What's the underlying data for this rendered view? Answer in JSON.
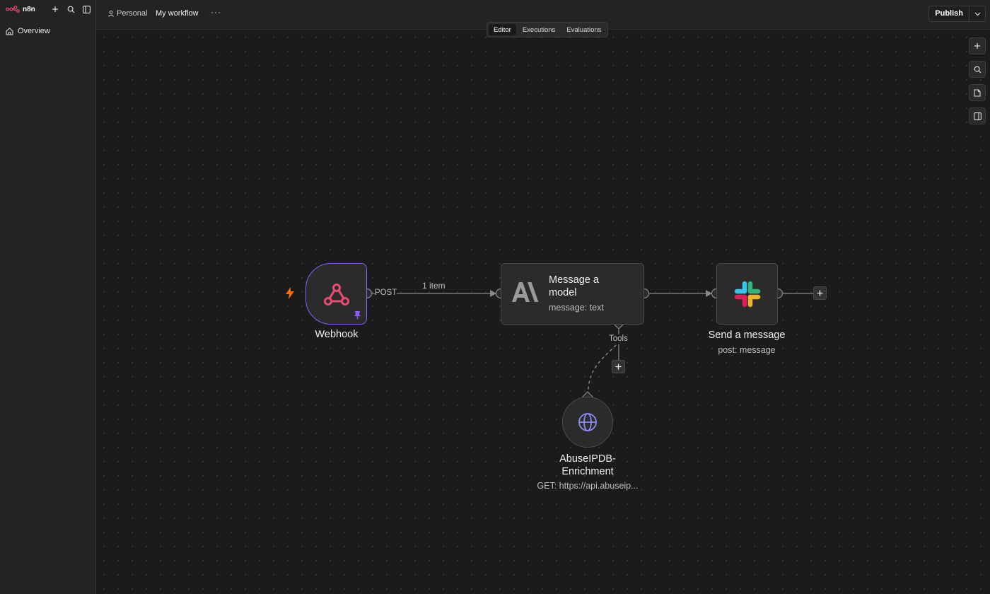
{
  "sidebar": {
    "brand": "n8n",
    "nav": [
      {
        "label": "Overview",
        "icon": "home-icon"
      }
    ]
  },
  "header": {
    "project": "Personal",
    "workflow_name": "My workflow",
    "more": "···",
    "publish_label": "Publish"
  },
  "tabs": [
    {
      "label": "Editor",
      "active": true
    },
    {
      "label": "Executions",
      "active": false
    },
    {
      "label": "Evaluations",
      "active": false
    }
  ],
  "nodes": {
    "webhook": {
      "title": "Webhook",
      "output_label": "POST"
    },
    "model": {
      "title": "Message a model",
      "subtitle": "message: text",
      "tools_label": "Tools"
    },
    "slack": {
      "title": "Send a message",
      "subtitle": "post: message"
    },
    "abuse": {
      "title": "AbuseIPDB-Enrichment",
      "subtitle": "GET: https://api.abuseip..."
    }
  },
  "edges": {
    "webhook_to_model": "1 item"
  },
  "colors": {
    "accent": "#8b5cf6",
    "brand": "#ea4b71",
    "trigger": "#ff6d00",
    "tool_icon": "#8c8cf5"
  }
}
